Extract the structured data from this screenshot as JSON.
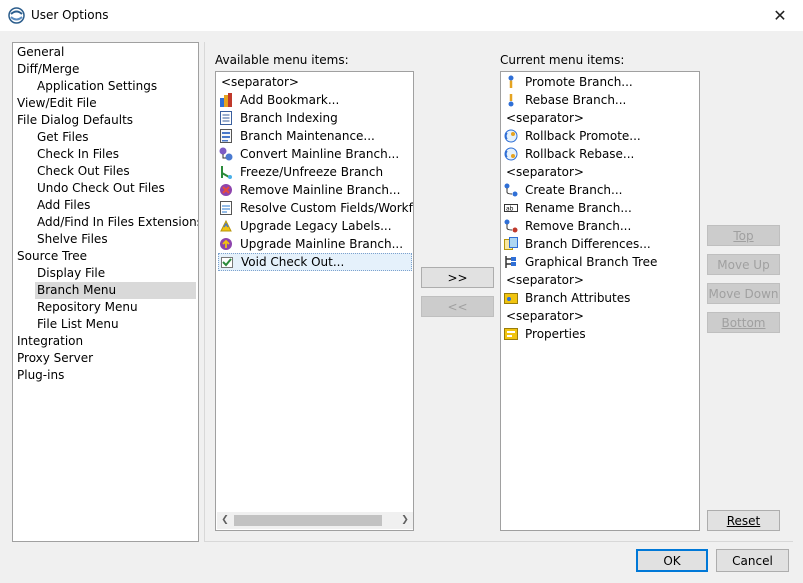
{
  "window": {
    "title": "User Options",
    "close_glyph": "✕"
  },
  "tree": {
    "items": [
      {
        "label": "General",
        "level": 0
      },
      {
        "label": "Diff/Merge",
        "level": 0
      },
      {
        "label": "Application Settings",
        "level": 1
      },
      {
        "label": "View/Edit File",
        "level": 0
      },
      {
        "label": "File Dialog Defaults",
        "level": 0
      },
      {
        "label": "Get Files",
        "level": 1
      },
      {
        "label": "Check In Files",
        "level": 1
      },
      {
        "label": "Check Out Files",
        "level": 1
      },
      {
        "label": "Undo Check Out Files",
        "level": 1
      },
      {
        "label": "Add Files",
        "level": 1
      },
      {
        "label": "Add/Find In Files Extensions",
        "level": 1
      },
      {
        "label": "Shelve Files",
        "level": 1
      },
      {
        "label": "Source Tree",
        "level": 0
      },
      {
        "label": "Display File",
        "level": 1
      },
      {
        "label": "Branch Menu",
        "level": 1,
        "selected": true
      },
      {
        "label": "Repository Menu",
        "level": 1
      },
      {
        "label": "File List Menu",
        "level": 1
      },
      {
        "label": "Integration",
        "level": 0
      },
      {
        "label": "Proxy Server",
        "level": 0
      },
      {
        "label": "Plug-ins",
        "level": 0
      }
    ]
  },
  "available": {
    "label": "Available menu items:",
    "items": [
      {
        "label": "<separator>",
        "icon": "none"
      },
      {
        "label": "Add Bookmark...",
        "icon": "bookmark-icon"
      },
      {
        "label": "Branch Indexing",
        "icon": "document-icon"
      },
      {
        "label": "Branch Maintenance...",
        "icon": "list-icon"
      },
      {
        "label": "Convert Mainline Branch...",
        "icon": "convert-icon"
      },
      {
        "label": "Freeze/Unfreeze Branch",
        "icon": "freeze-icon"
      },
      {
        "label": "Remove Mainline Branch...",
        "icon": "remove-mainline-icon"
      },
      {
        "label": "Resolve Custom Fields/Workflow",
        "icon": "resolve-icon"
      },
      {
        "label": "Upgrade Legacy Labels...",
        "icon": "upgrade-labels-icon"
      },
      {
        "label": "Upgrade Mainline Branch...",
        "icon": "upgrade-mainline-icon"
      },
      {
        "label": "Void Check Out...",
        "icon": "void-checkout-icon",
        "selected": true
      }
    ]
  },
  "current": {
    "label": "Current menu items:",
    "items": [
      {
        "label": "Promote Branch...",
        "icon": "promote-icon"
      },
      {
        "label": "Rebase Branch...",
        "icon": "rebase-icon"
      },
      {
        "label": "<separator>",
        "icon": "none"
      },
      {
        "label": "Rollback Promote...",
        "icon": "rollback-promote-icon"
      },
      {
        "label": "Rollback Rebase...",
        "icon": "rollback-rebase-icon"
      },
      {
        "label": "<separator>",
        "icon": "none"
      },
      {
        "label": "Create Branch...",
        "icon": "create-branch-icon"
      },
      {
        "label": "Rename Branch...",
        "icon": "rename-branch-icon"
      },
      {
        "label": "Remove Branch...",
        "icon": "remove-branch-icon"
      },
      {
        "label": "Branch Differences...",
        "icon": "differences-icon"
      },
      {
        "label": "Graphical Branch Tree",
        "icon": "branch-tree-icon"
      },
      {
        "label": "<separator>",
        "icon": "none"
      },
      {
        "label": "Branch Attributes",
        "icon": "attributes-icon"
      },
      {
        "label": "<separator>",
        "icon": "none"
      },
      {
        "label": "Properties",
        "icon": "properties-icon"
      }
    ]
  },
  "buttons": {
    "add": ">>",
    "remove": "<<",
    "top": "Top",
    "move_up": "Move Up",
    "move_down": "Move Down",
    "bottom": "Bottom",
    "reset": "Reset",
    "ok": "OK",
    "cancel": "Cancel"
  },
  "colors": {
    "selection_bg": "#e5f1fb",
    "tree_selection_bg": "#d9d9d9",
    "primary_border": "#0078d7"
  }
}
